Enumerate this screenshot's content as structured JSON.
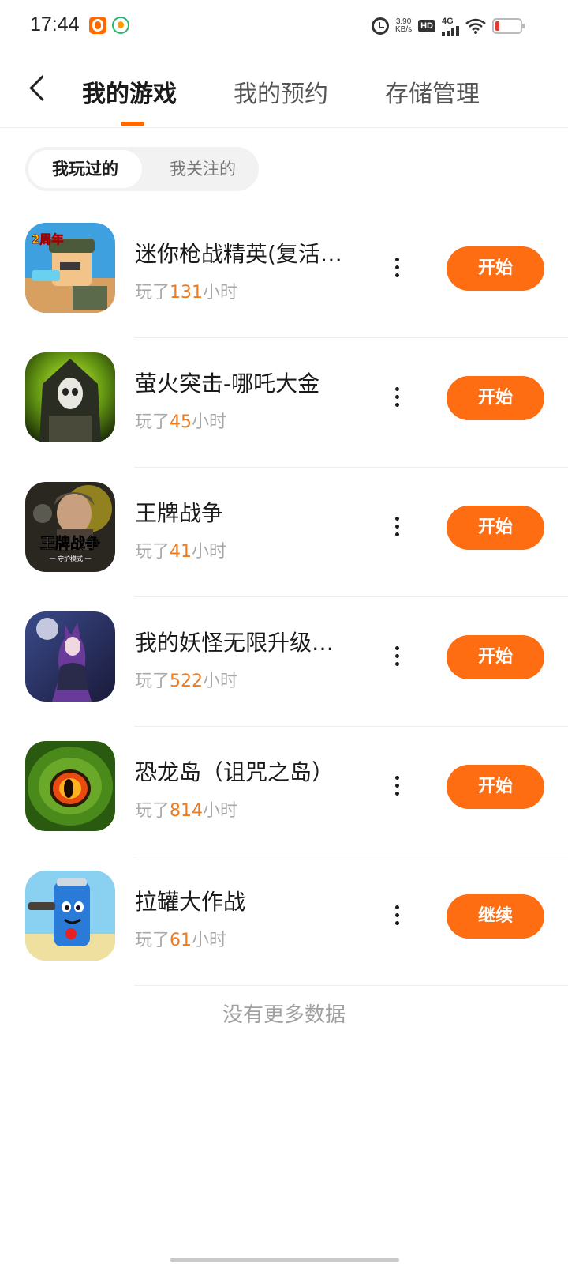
{
  "status_bar": {
    "time": "17:44",
    "net_speed_value": "3.90",
    "net_speed_unit": "KB/s",
    "hd_label": "HD",
    "network_label": "4G"
  },
  "header": {
    "tabs": [
      {
        "label": "我的游戏",
        "active": true
      },
      {
        "label": "我的预约",
        "active": false
      },
      {
        "label": "存储管理",
        "active": false
      }
    ],
    "accent_color": "#ff6a00"
  },
  "segment": {
    "items": [
      {
        "label": "我玩过的",
        "active": true
      },
      {
        "label": "我关注的",
        "active": false
      }
    ]
  },
  "games": [
    {
      "name": "迷你枪战精英(复活…",
      "played_prefix": "玩了",
      "hours": "131",
      "hours_unit": "小时",
      "action": "开始"
    },
    {
      "name": "萤火突击-哪吒大金",
      "played_prefix": "玩了",
      "hours": "45",
      "hours_unit": "小时",
      "action": "开始"
    },
    {
      "name": "王牌战争",
      "played_prefix": "玩了",
      "hours": "41",
      "hours_unit": "小时",
      "action": "开始",
      "icon_text": "王牌战争",
      "icon_subtext": "一 守护模式 一"
    },
    {
      "name": "我的妖怪无限升级…",
      "played_prefix": "玩了",
      "hours": "522",
      "hours_unit": "小时",
      "action": "开始"
    },
    {
      "name": "恐龙岛（诅咒之岛）",
      "played_prefix": "玩了",
      "hours": "814",
      "hours_unit": "小时",
      "action": "开始"
    },
    {
      "name": "拉罐大作战",
      "played_prefix": "玩了",
      "hours": "61",
      "hours_unit": "小时",
      "action": "继续"
    }
  ],
  "first_icon_badge": "2周年",
  "footer_text": "没有更多数据"
}
